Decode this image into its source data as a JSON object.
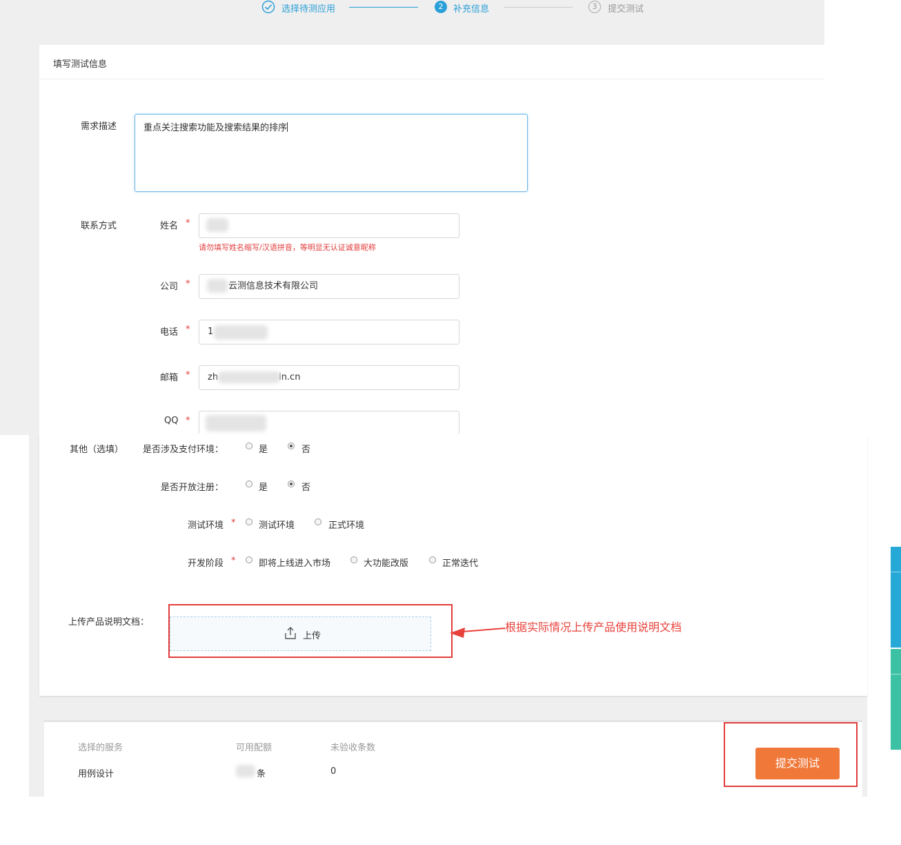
{
  "steps": [
    {
      "num": "✓",
      "label": "选择待测应用",
      "state": "done"
    },
    {
      "num": "2",
      "label": "补充信息",
      "state": "active"
    },
    {
      "num": "3",
      "label": "提交测试",
      "state": "pending"
    }
  ],
  "section_title": "填写测试信息",
  "demand": {
    "label": "需求描述",
    "value": "重点关注搜索功能及搜索结果的排序"
  },
  "contact": {
    "label": "联系方式",
    "name_label": "姓名",
    "name_value": "",
    "name_hint": "请勿填写姓名缩写/汉语拼音，等明显无认证诚意昵称",
    "company_label": "公司",
    "company_value": "云测信息技术有限公司",
    "phone_label": "电话",
    "phone_value": "1",
    "email_label": "邮箱",
    "email_value_left": "zh",
    "email_value_right": "in.cn",
    "qq_label": "QQ",
    "required_mark": "*"
  },
  "other": {
    "label": "其他（选填）",
    "payment": {
      "label": "是否涉及支付环境：",
      "options": [
        "是",
        "否"
      ],
      "selected": "否"
    },
    "register": {
      "label": "是否开放注册：",
      "options": [
        "是",
        "否"
      ],
      "selected": "否"
    },
    "env": {
      "label": "测试环境",
      "options": [
        "测试环境",
        "正式环境"
      ],
      "selected": ""
    },
    "stage": {
      "label": "开发阶段",
      "options": [
        "即将上线进入市场",
        "大功能改版",
        "正常迭代"
      ],
      "selected": ""
    }
  },
  "upload": {
    "label": "上传产品说明文档：",
    "button": "上传",
    "icon": "upload-icon"
  },
  "annotation": {
    "text": "根据实际情况上传产品使用说明文档",
    "color": "#e8413b"
  },
  "summary": {
    "headers": [
      "选择的服务",
      "可用配额",
      "未验收条数"
    ],
    "service": "用例设计",
    "quota_unit": "条",
    "unaccepted": "0"
  },
  "submit_button": "提交测试",
  "colors": {
    "accent": "#2a9fd8",
    "submit": "#f0793a",
    "annotation": "#e8413b",
    "side_tab_blue": "#27a9d8",
    "side_tab_green": "#3dc1a5"
  }
}
